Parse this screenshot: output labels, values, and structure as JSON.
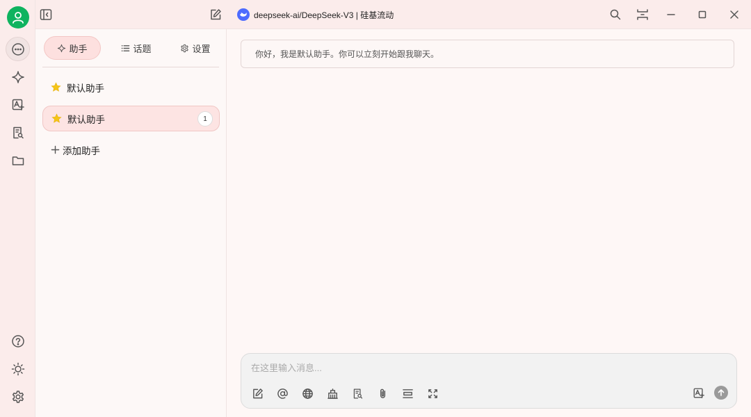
{
  "titlebar": {
    "model_name": "deepseek-ai/DeepSeek-V3 | 硅基流动"
  },
  "tabs": [
    {
      "label": "助手",
      "icon": "sparkle-icon",
      "active": true
    },
    {
      "label": "话题",
      "icon": "list-icon",
      "active": false
    },
    {
      "label": "设置",
      "icon": "gear-icon",
      "active": false
    }
  ],
  "assistants": [
    {
      "label": "默认助手",
      "icon": "star-icon"
    },
    {
      "label": "默认助手",
      "icon": "star-icon",
      "selected": true,
      "badge": "1"
    }
  ],
  "add_assistant_label": "添加助手",
  "chat": {
    "greeting": "你好，我是默认助手。你可以立刻开始跟我聊天。"
  },
  "composer": {
    "placeholder": "在这里输入消息..."
  },
  "colors": {
    "avatar": "#0fb35f",
    "accent_bg": "#fde0df",
    "star": "#f5c518",
    "deepseek_blue": "#4d6bfe"
  }
}
